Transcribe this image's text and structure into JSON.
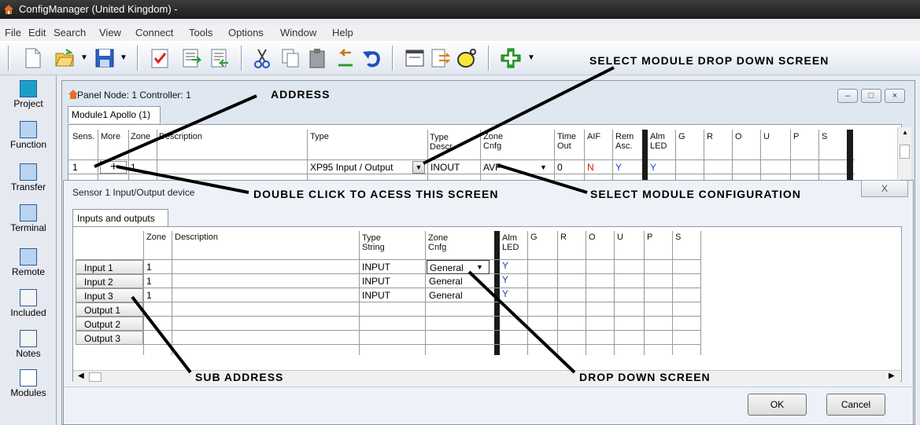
{
  "window": {
    "title": "ConfigManager (United Kingdom) -"
  },
  "menu": [
    "File",
    "Edit",
    "Search",
    "View",
    "Connect",
    "Tools",
    "Options",
    "Window",
    "Help"
  ],
  "toolbar": {
    "icons": [
      "new-doc-icon",
      "open-folder-icon",
      "save-icon",
      "check-icon",
      "export-icon",
      "import-icon",
      "cut-icon",
      "copy-icon",
      "paste-icon",
      "back-icon",
      "undo-icon",
      "panel-icon",
      "transfer-icon",
      "mask-icon",
      "add-icon"
    ]
  },
  "sidebar": {
    "items": [
      {
        "label": "Project",
        "icon": "project-icon"
      },
      {
        "label": "Function",
        "icon": "function-icon"
      },
      {
        "label": "Transfer",
        "icon": "transfer-icon"
      },
      {
        "label": "Terminal",
        "icon": "terminal-icon"
      },
      {
        "label": "Remote",
        "icon": "remote-icon"
      },
      {
        "label": "Included",
        "icon": "included-icon"
      },
      {
        "label": "Notes",
        "icon": "notes-icon"
      },
      {
        "label": "Modules",
        "icon": "modules-icon"
      }
    ]
  },
  "panel": {
    "title": "Panel Node: 1 Controller: 1",
    "tab": "Module1 Apollo (1)",
    "headers": {
      "sens": "Sens.",
      "more": "More",
      "zone": "Zone",
      "description": "Description",
      "type": "Type",
      "type_descr_1": "Type",
      "type_descr_2": "Descr.",
      "zone_cnfg_1": "Zone",
      "zone_cnfg_2": "Cnfg",
      "time_out_1": "Time",
      "time_out_2": "Out",
      "aif": "AIF",
      "rem_asc_1": "Rem",
      "rem_asc_2": "Asc.",
      "alm_led_1": "Alm",
      "alm_led_2": "LED",
      "g": "G",
      "r": "R",
      "o": "O",
      "u": "U",
      "p": "P",
      "s": "S"
    },
    "row": {
      "sens": "1",
      "more": "+",
      "zone": "1",
      "description": "",
      "type": "XP95 Input / Output",
      "type_descr": "INOUT",
      "zone_cnfg": "AVF",
      "time_out": "0",
      "aif": "N",
      "rem_asc": "Y",
      "alm_led": "Y"
    }
  },
  "dialog": {
    "title": "Sensor 1 Input/Output device",
    "close": "X",
    "tab": "Inputs and outputs",
    "headers": {
      "zone": "Zone",
      "description": "Description",
      "type_string_1": "Type",
      "type_string_2": "String",
      "zone_cnfg_1": "Zone",
      "zone_cnfg_2": "Cnfg",
      "alm_led_1": "Alm",
      "alm_led_2": "LED",
      "g": "G",
      "r": "R",
      "o": "O",
      "u": "U",
      "p": "P",
      "s": "S"
    },
    "rows": [
      {
        "label": "Input 1",
        "zone": "1",
        "type": "INPUT",
        "cnfg": "General",
        "led": "Y"
      },
      {
        "label": "Input 2",
        "zone": "1",
        "type": "INPUT",
        "cnfg": "General",
        "led": "Y"
      },
      {
        "label": "Input 3",
        "zone": "1",
        "type": "INPUT",
        "cnfg": "General",
        "led": "Y"
      },
      {
        "label": "Output 1",
        "zone": "",
        "type": "",
        "cnfg": "",
        "led": ""
      },
      {
        "label": "Output 2",
        "zone": "",
        "type": "",
        "cnfg": "",
        "led": ""
      },
      {
        "label": "Output 3",
        "zone": "",
        "type": "",
        "cnfg": "",
        "led": ""
      }
    ],
    "ok": "OK",
    "cancel": "Cancel"
  },
  "annotations": {
    "select_module_drop_down": "SELECT MODULE DROP DOWN SCREEN",
    "address": "ADDRESS",
    "double_click": "DOUBLE CLICK TO ACESS THIS SCREEN",
    "select_module_config": "SELECT MODULE CONFIGURATION",
    "sub_address": "SUB ADDRESS",
    "drop_down_screen": "DROP DOWN SCREEN"
  }
}
